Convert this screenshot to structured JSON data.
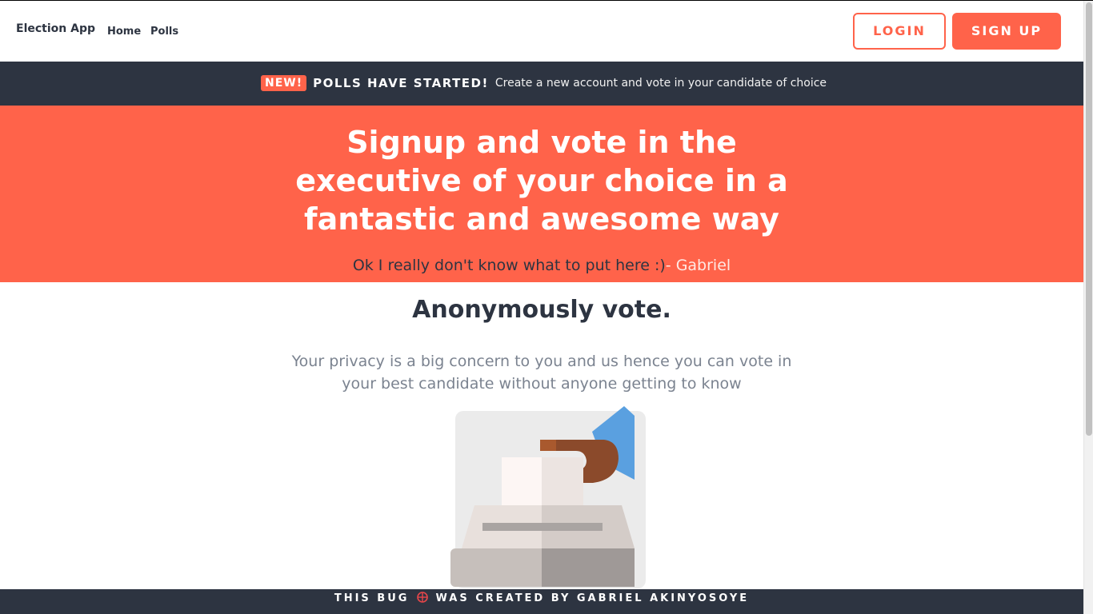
{
  "navbar": {
    "brand": "Election App",
    "links": [
      "Home",
      "Polls"
    ],
    "login_label": "LOGIN",
    "signup_label": "SIGN UP"
  },
  "announcement": {
    "badge": "NEW!",
    "headline": "POLLS HAVE STARTED!",
    "text": "Create a new account and vote in your candidate of choice"
  },
  "hero": {
    "title": "Signup and vote in the executive of your choice in a fantastic and awesome way",
    "subtitle": "Ok I really don't know what to put here :)",
    "author": "- Gabriel"
  },
  "feature": {
    "title": "Anonymously vote.",
    "text": "Your privacy is a big concern to you and us hence you can vote in your best candidate without anyone getting to know",
    "image_icon": "ballot-box-icon"
  },
  "footer": {
    "text_before": "THIS BUG",
    "icon": "bug-icon",
    "text_after": "WAS CREATED BY GABRIEL AKINYOSOYE"
  },
  "colors": {
    "accent": "#ff634a",
    "dark": "#2d3441",
    "muted": "#7b8390"
  }
}
